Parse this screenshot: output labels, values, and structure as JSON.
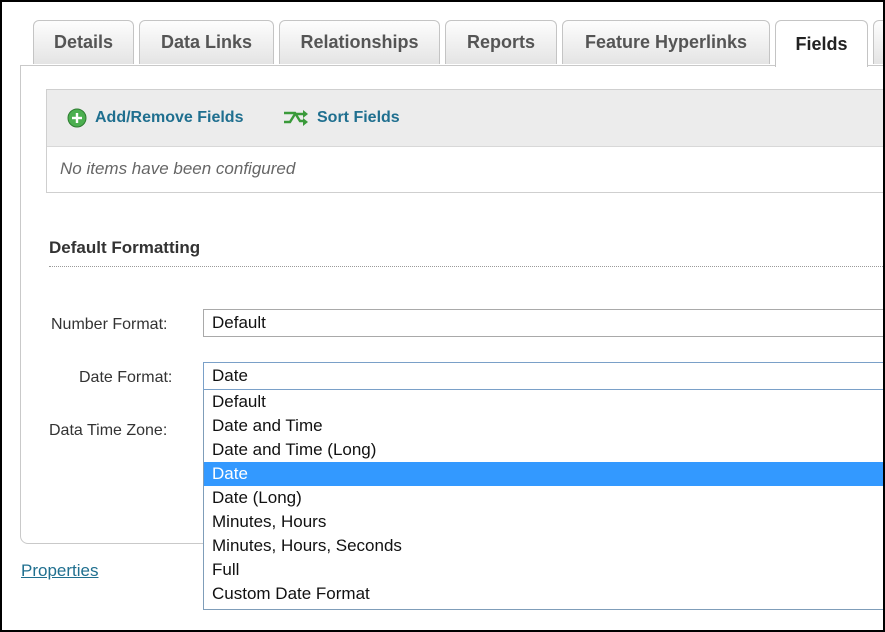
{
  "tabs": [
    {
      "label": "Details",
      "active": false
    },
    {
      "label": "Data Links",
      "active": false
    },
    {
      "label": "Relationships",
      "active": false
    },
    {
      "label": "Reports",
      "active": false
    },
    {
      "label": "Feature Hyperlinks",
      "active": false
    },
    {
      "label": "Fields",
      "active": true
    }
  ],
  "toolbar": {
    "add_remove_label": "Add/Remove Fields",
    "add_remove_icon": "add-circle-icon",
    "sort_label": "Sort Fields",
    "sort_icon": "sort-icon"
  },
  "fields_list": {
    "empty_message": "No items have been configured"
  },
  "default_formatting": {
    "title": "Default Formatting",
    "number_format": {
      "label": "Number Format:",
      "value": "Default"
    },
    "date_format": {
      "label": "Date Format:",
      "value": "Date",
      "options": [
        "Default",
        "Date and Time",
        "Date and Time (Long)",
        "Date",
        "Date (Long)",
        "Minutes, Hours",
        "Minutes, Hours, Seconds",
        "Full",
        "Custom Date Format"
      ],
      "selected_index": 3
    },
    "data_time_zone": {
      "label": "Data Time Zone:"
    }
  },
  "footer": {
    "properties_link": "Properties"
  },
  "colors": {
    "link": "#1f6f8f",
    "selection": "#3399ff",
    "add_icon": "#4caf50",
    "sort_icon": "#3a9a3a"
  }
}
